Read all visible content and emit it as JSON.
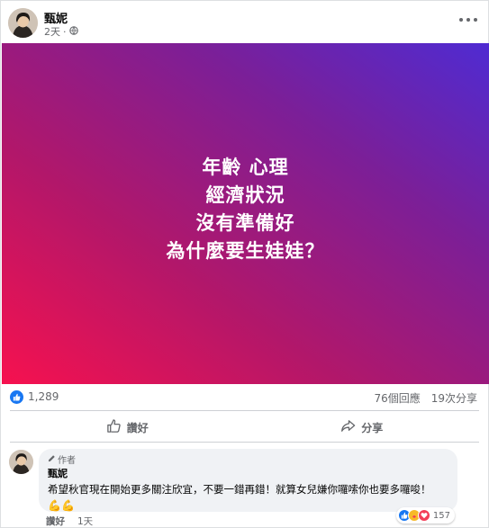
{
  "post": {
    "author": "甄妮",
    "time": "2天",
    "privacy_icon": "globe-icon",
    "banner_lines": [
      "年齡 心理",
      "經濟狀況",
      "沒有準備好",
      "為什麼要生娃娃？"
    ],
    "banner_colors": {
      "bottom_left": "#f6114f",
      "top_right": "#4f2bd2"
    }
  },
  "stats": {
    "likes": "1,289",
    "comments": "76個回應",
    "shares": "19次分享"
  },
  "actions": {
    "like_label": "讚好",
    "share_label": "分享"
  },
  "comment": {
    "author_tag": "作者",
    "author": "甄妮",
    "text": "希望秋官現在開始更多關注欣宜，不要一錯再錯！就算女兒嫌你囉嗦你也要多囉唆！",
    "emoji": "💪💪",
    "reaction_count": "157",
    "like_label": "讚好",
    "time": "1天"
  },
  "accent_color": "#1877f2"
}
